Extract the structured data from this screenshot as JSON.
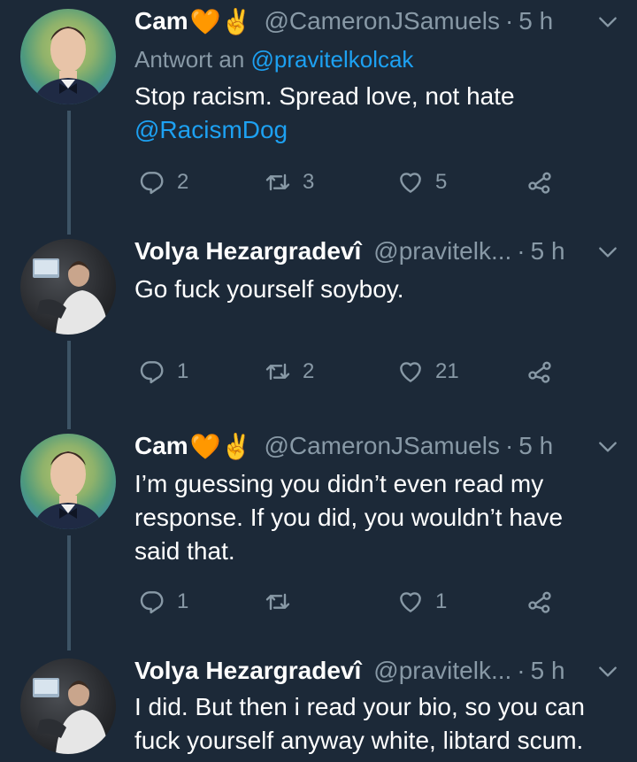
{
  "tweets": [
    {
      "name": "Cam",
      "emojis": "🧡✌",
      "handle": "@CameronJSamuels",
      "dot": "·",
      "time": "5 h",
      "reply_prefix": "Antwort an",
      "reply_handle": "@pravitelkolcak",
      "body": "Stop racism. Spread love, not hate",
      "body_mention": "@RacismDog",
      "reply_count": "2",
      "retweet_count": "3",
      "like_count": "5"
    },
    {
      "name": "Volya Hezargradevî",
      "handle": "@pravitelk...",
      "dot": "·",
      "time": "5 h",
      "body": "Go fuck yourself soyboy.",
      "reply_count": "1",
      "retweet_count": "2",
      "like_count": "21"
    },
    {
      "name": "Cam",
      "emojis": "🧡✌",
      "handle": "@CameronJSamuels",
      "dot": "·",
      "time": "5 h",
      "body": "I’m guessing you didn’t even read my response. If you did, you wouldn’t have said that.",
      "reply_count": "1",
      "retweet_count": "",
      "like_count": "1"
    },
    {
      "name": "Volya Hezargradevî",
      "handle": "@pravitelk...",
      "dot": "·",
      "time": "5 h",
      "body": "I did. But then i read your bio, so you can fuck yourself anyway white, libtard scum."
    }
  ],
  "colors": {
    "background": "#1c2938",
    "secondary_text": "#8899a6",
    "link": "#1da1f2",
    "thread_line": "#3d5466",
    "heart_emoji": "#f4900c"
  },
  "icons": {
    "reply": "reply-icon",
    "retweet": "retweet-icon",
    "like": "heart-icon",
    "share": "share-icon",
    "caret": "chevron-down-icon"
  }
}
